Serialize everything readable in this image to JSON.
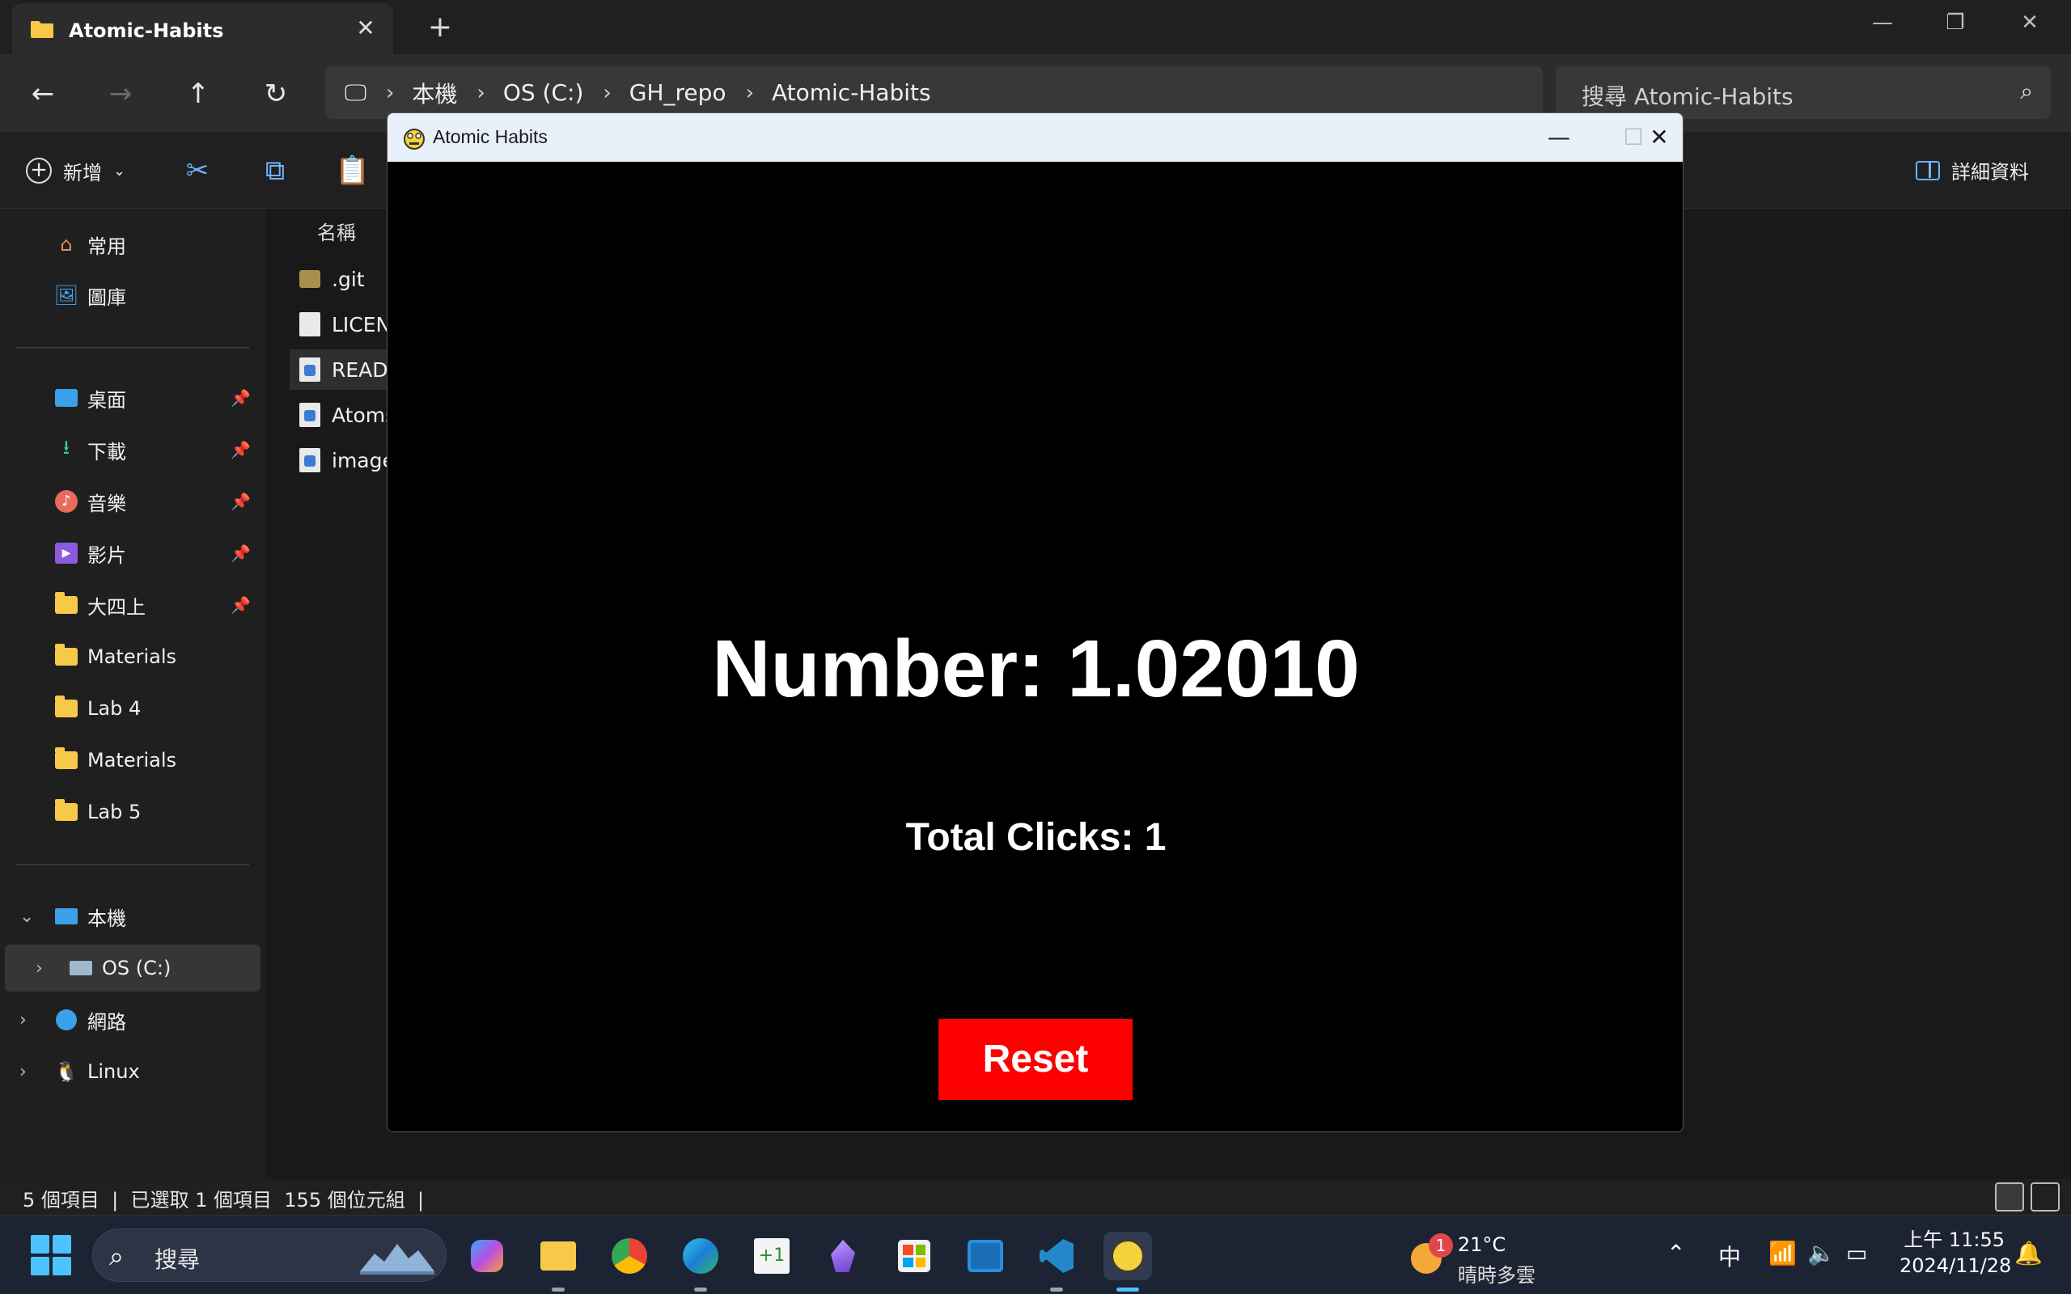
{
  "explorer": {
    "tab_title": "Atomic-Habits",
    "breadcrumb": [
      "本機",
      "OS (C:)",
      "GH_repo",
      "Atomic-Habits"
    ],
    "search_placeholder": "搜尋 Atomic-Habits",
    "new_label": "新增",
    "details_label": "詳細資料",
    "column_name": "名稱",
    "sidebar": {
      "quick": [
        {
          "label": "常用",
          "icon": "home-icon"
        },
        {
          "label": "圖庫",
          "icon": "gallery-icon"
        }
      ],
      "pinned": [
        {
          "label": "桌面",
          "icon": "desktop-icon"
        },
        {
          "label": "下載",
          "icon": "download-icon"
        },
        {
          "label": "音樂",
          "icon": "music-icon"
        },
        {
          "label": "影片",
          "icon": "video-icon"
        },
        {
          "label": "大四上",
          "icon": "folder-icon"
        },
        {
          "label": "Materials",
          "icon": "folder-icon"
        },
        {
          "label": "Lab 4",
          "icon": "folder-icon"
        },
        {
          "label": "Materials",
          "icon": "folder-icon"
        },
        {
          "label": "Lab 5",
          "icon": "folder-icon"
        }
      ],
      "tree": [
        {
          "label": "本機",
          "icon": "pc-icon"
        },
        {
          "label": "OS (C:)",
          "icon": "drive-icon"
        },
        {
          "label": "網路",
          "icon": "network-icon"
        },
        {
          "label": "Linux",
          "icon": "linux-icon"
        }
      ]
    },
    "files": [
      ".git",
      "LICENS",
      "READM",
      "Atoms",
      "image"
    ],
    "status": "5 個項目  |  已選取 1 個項目  155 個位元組  |"
  },
  "pygame": {
    "window_title": "Atomic Habits",
    "number_text": "Number: 1.02010",
    "clicks_text": "Total Clicks: 1",
    "reset_label": "Reset",
    "colors": {
      "background": "#000000",
      "text": "#ffffff",
      "button": "#ff0000"
    }
  },
  "taskbar": {
    "search_placeholder": "搜尋",
    "weather_temp": "21°C",
    "weather_cond": "晴時多雲",
    "weather_badge": "1",
    "ime": "中",
    "time": "上午 11:55",
    "date": "2024/11/28"
  }
}
